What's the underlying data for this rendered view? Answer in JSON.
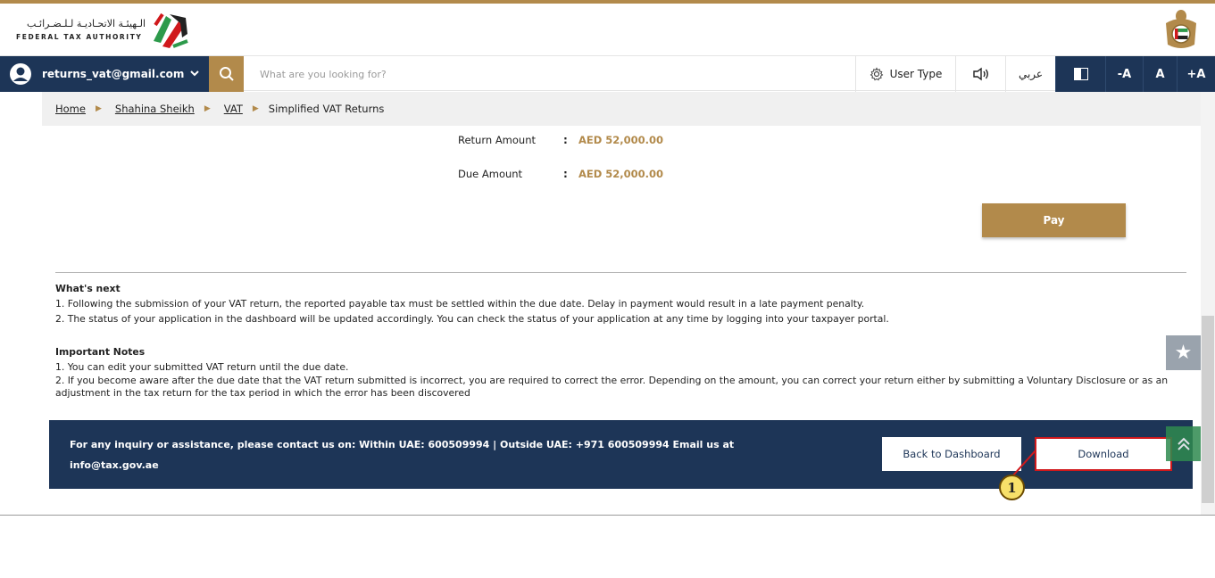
{
  "header": {
    "org_name_ar": "الـهيئـة الاتحـاديـة لـلـضـرائـب",
    "org_name_en": "FEDERAL TAX AUTHORITY"
  },
  "navbar": {
    "user_email": "returns_vat@gmail.com",
    "search_placeholder": "What are you looking for?",
    "user_type_label": "User Type",
    "language_label": "عربي",
    "font_decrease_label": "-A",
    "font_normal_label": "A",
    "font_increase_label": "+A"
  },
  "breadcrumb": {
    "items": [
      "Home",
      "Shahina Sheikh",
      "VAT"
    ],
    "current": "Simplified VAT Returns"
  },
  "summary": {
    "return_amount_label": "Return Amount",
    "return_amount_value": "AED 52,000.00",
    "due_amount_label": "Due Amount",
    "due_amount_value": "AED 52,000.00",
    "colon": ":"
  },
  "pay_button": "Pay",
  "whats_next": {
    "heading": "What's next",
    "items": [
      "1. Following the submission of your VAT return, the reported payable tax must be settled within the due date. Delay in payment would result in a late payment penalty.",
      "2. The status of your application in the dashboard will be updated accordingly. You can check the status of your application at any time by logging into your taxpayer portal."
    ]
  },
  "important_notes": {
    "heading": "Important Notes",
    "items": [
      "1. You can edit your submitted VAT return until the due date.",
      "2. If you become aware after the due date that the VAT return submitted is incorrect, you are required to correct the error. Depending on the amount, you can correct your return either by submitting a Voluntary Disclosure or as an adjustment in the tax return for the tax period in which the error has been discovered"
    ]
  },
  "footer": {
    "contact_line1": "For any inquiry or assistance, please contact us on: Within UAE: 600509994 | Outside UAE: +971 600509994 Email us at",
    "contact_line2": "info@tax.gov.ae",
    "back_button": "Back to Dashboard",
    "download_button": "Download"
  },
  "annotation": {
    "callout_number": "1"
  },
  "colors": {
    "brand_gold": "#b28a4b",
    "navy": "#1d3557",
    "highlight_red": "#d0191c",
    "callout_yellow": "#f7e06a"
  },
  "icons": [
    "user-avatar-icon",
    "chevron-down-icon",
    "search-icon",
    "gear-icon",
    "speaker-icon",
    "contrast-icon",
    "star-icon",
    "chevron-up-icon",
    "fta-logo-icon",
    "uae-emblem-icon"
  ]
}
